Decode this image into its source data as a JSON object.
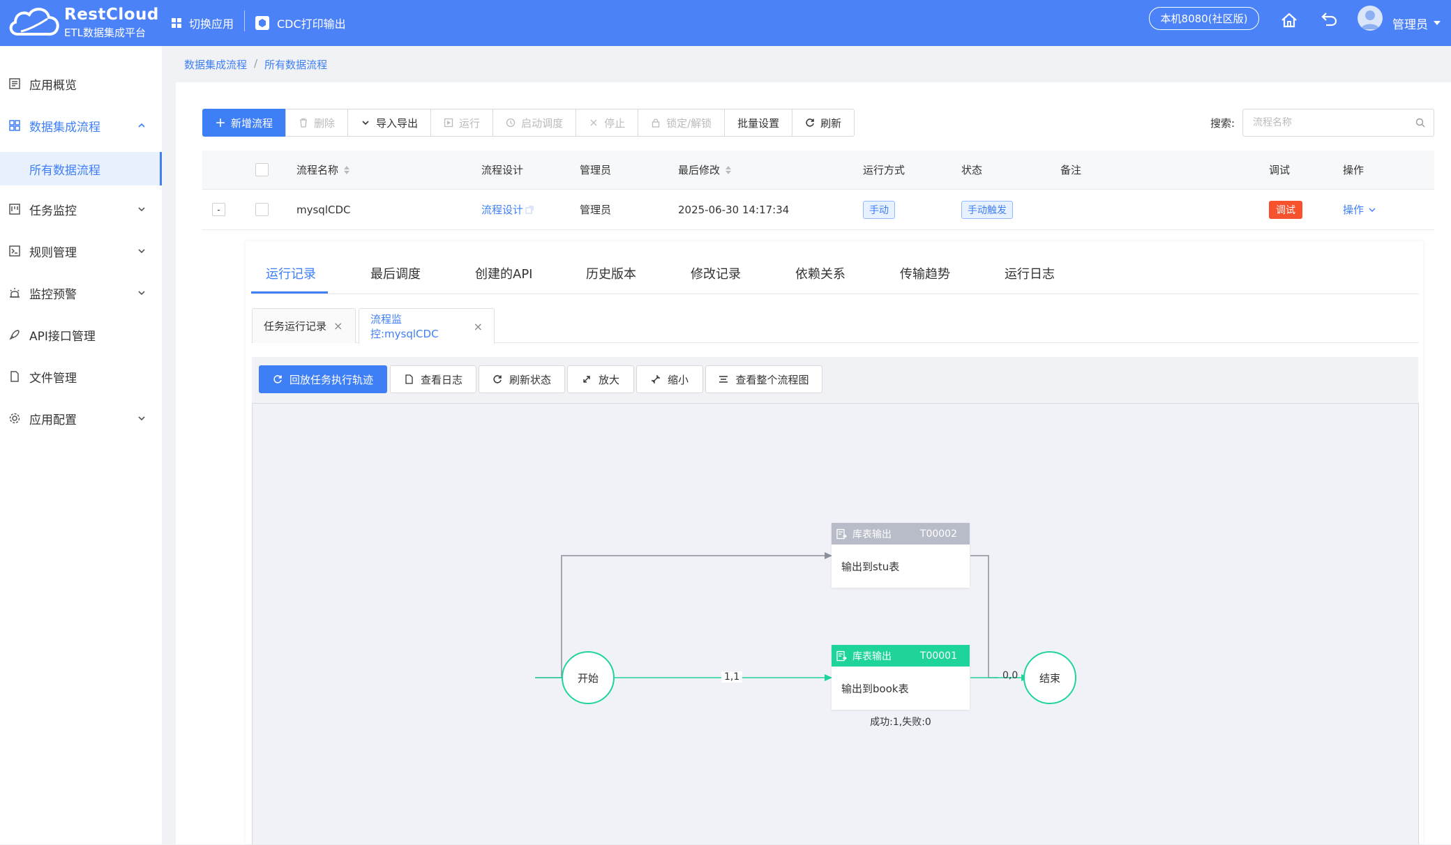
{
  "header": {
    "brand_title": "RestCloud",
    "brand_subtitle": "ETL数据集成平台",
    "switch_app": "切换应用",
    "current_app": "CDC打印输出",
    "env": "本机8080(社区版)",
    "user": "管理员"
  },
  "sidebar": {
    "items": [
      {
        "label": "应用概览",
        "icon": "list-icon"
      },
      {
        "label": "数据集成流程",
        "icon": "grid-icon",
        "expanded": true
      },
      {
        "label": "所有数据流程",
        "sub": true,
        "active": true
      },
      {
        "label": "任务监控",
        "icon": "monitor-icon"
      },
      {
        "label": "规则管理",
        "icon": "terminal-icon"
      },
      {
        "label": "监控预警",
        "icon": "alarm-icon"
      },
      {
        "label": "API接口管理",
        "icon": "rocket-icon"
      },
      {
        "label": "文件管理",
        "icon": "file-icon"
      },
      {
        "label": "应用配置",
        "icon": "gear-icon"
      }
    ]
  },
  "breadcrumb": [
    "数据集成流程",
    "所有数据流程"
  ],
  "toolbar": {
    "new": "新增流程",
    "delete": "删除",
    "import_export": "导入导出",
    "run": "运行",
    "schedule": "启动调度",
    "stop": "停止",
    "lock": "锁定/解锁",
    "batch": "批量设置",
    "refresh": "刷新"
  },
  "search": {
    "label": "搜索:",
    "placeholder": "流程名称"
  },
  "table": {
    "columns": [
      "流程名称",
      "流程设计",
      "管理员",
      "最后修改",
      "运行方式",
      "状态",
      "备注",
      "调试",
      "操作"
    ],
    "rows": [
      {
        "expand": "-",
        "name": "mysqlCDC",
        "design": "流程设计",
        "admin": "管理员",
        "modified": "2025-06-30 14:17:34",
        "run_mode": "手动",
        "status": "手动触发",
        "note": "",
        "debug": "调试",
        "action": "操作"
      }
    ]
  },
  "detail_tabs": [
    "运行记录",
    "最后调度",
    "创建的API",
    "历史版本",
    "修改记录",
    "依赖关系",
    "传输趋势",
    "运行日志"
  ],
  "sub_tabs": [
    "任务运行记录",
    "流程监控:mysqlCDC"
  ],
  "flow_toolbar": {
    "replay": "回放任务执行轨迹",
    "view_log": "查看日志",
    "refresh_status": "刷新状态",
    "zoom_in": "放大",
    "zoom_out": "缩小",
    "view_all": "查看整个流程图"
  },
  "flow": {
    "start": "开始",
    "end": "结束",
    "nodes": [
      {
        "type": "库表输出",
        "id": "T00002",
        "body": "输出到stu表",
        "header_color": "#b7bcc8"
      },
      {
        "type": "库表输出",
        "id": "T00001",
        "body": "输出到book表",
        "header_color": "#1fd49b",
        "stats": "成功:1,失败:0"
      }
    ],
    "edge_labels": [
      "1,1",
      "0,0"
    ],
    "active_color": "#1fd49b",
    "inactive_color": "#8a8f99"
  },
  "colors": {
    "primary": "#4c82f7",
    "accent": "#3f7ff6",
    "danger": "#f5522d"
  }
}
